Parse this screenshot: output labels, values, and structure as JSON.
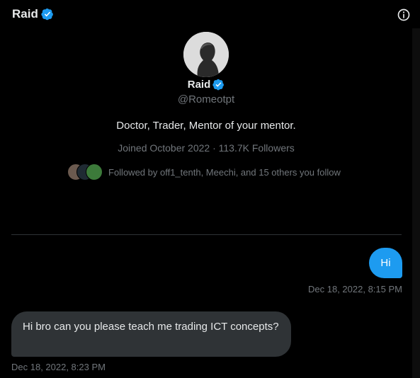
{
  "header": {
    "title": "Raid",
    "info_icon": "info-icon",
    "verified_icon": "verified-badge-icon"
  },
  "profile": {
    "name": "Raid",
    "handle": "@Romeotpt",
    "bio": "Doctor, Trader, Mentor of your mentor.",
    "meta": "Joined October 2022 · 113.7K Followers",
    "followed_by": "Followed by off1_tenth, Meechi, and 15 others you follow"
  },
  "messages": [
    {
      "direction": "outgoing",
      "text": "Hi",
      "time": "Dec 18, 2022, 8:15 PM"
    },
    {
      "direction": "incoming",
      "text": "Hi bro can you please teach me trading ICT concepts?",
      "time": "Dec 18, 2022, 8:23 PM"
    }
  ],
  "colors": {
    "background": "#000000",
    "accent": "#1d9bf0",
    "incoming_bubble": "#2f3336",
    "secondary_text": "#71767b"
  }
}
